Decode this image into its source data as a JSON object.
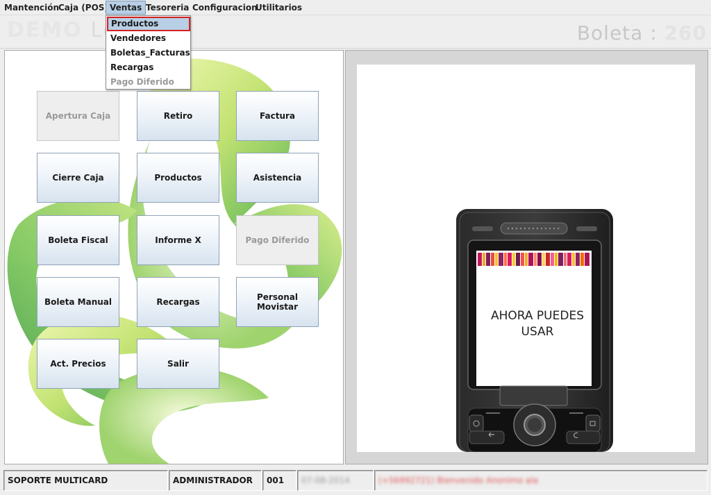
{
  "menubar": {
    "items": [
      "Mantención",
      "Caja (POS)",
      "Ventas",
      "Tesoreria",
      "Configuracion",
      "Utilitarios"
    ]
  },
  "ventas_menu": {
    "items": [
      {
        "label": "Productos",
        "state": "selected"
      },
      {
        "label": "Vendedores",
        "state": "enabled"
      },
      {
        "label": "Boletas_Facturas",
        "state": "enabled"
      },
      {
        "label": "Recargas",
        "state": "enabled"
      },
      {
        "label": "Pago Diferido",
        "state": "disabled"
      }
    ]
  },
  "header": {
    "left_text_ghost": "DEMO",
    "left_text": "Lo",
    "right_text": "Boleta : ",
    "right_text_ghost": "260"
  },
  "buttons": [
    {
      "label": "Apertura Caja",
      "enabled": false
    },
    {
      "label": "Retiro",
      "enabled": true
    },
    {
      "label": "Factura",
      "enabled": true
    },
    {
      "label": "Cierre Caja",
      "enabled": true
    },
    {
      "label": "Productos",
      "enabled": true
    },
    {
      "label": "Asistencia",
      "enabled": true
    },
    {
      "label": "Boleta Fiscal",
      "enabled": true
    },
    {
      "label": "Informe X",
      "enabled": true
    },
    {
      "label": "Pago Diferido",
      "enabled": false
    },
    {
      "label": "Boleta Manual",
      "enabled": true
    },
    {
      "label": "Recargas",
      "enabled": true
    },
    {
      "label": "Personal Movistar",
      "enabled": true
    },
    {
      "label": "Act. Precios",
      "enabled": true
    },
    {
      "label": "Salir",
      "enabled": true
    }
  ],
  "ad": {
    "line1": "AHORA PUEDES",
    "line2": "USAR"
  },
  "statusbar": {
    "support": "SOPORTE MULTICARD",
    "user": "ADMINISTRADOR",
    "terminal": "001",
    "date_blurred": "07-08-2014",
    "info_blurred": "(+56992721) Bienvenido Anonimo ala"
  },
  "colors": {
    "menu_highlight": "#b8cfe5",
    "selection_border": "#d42020",
    "button_gradient_top": "#ffffff",
    "button_gradient_bottom": "#d7e3ef",
    "disabled_text": "#9a9a9a"
  }
}
